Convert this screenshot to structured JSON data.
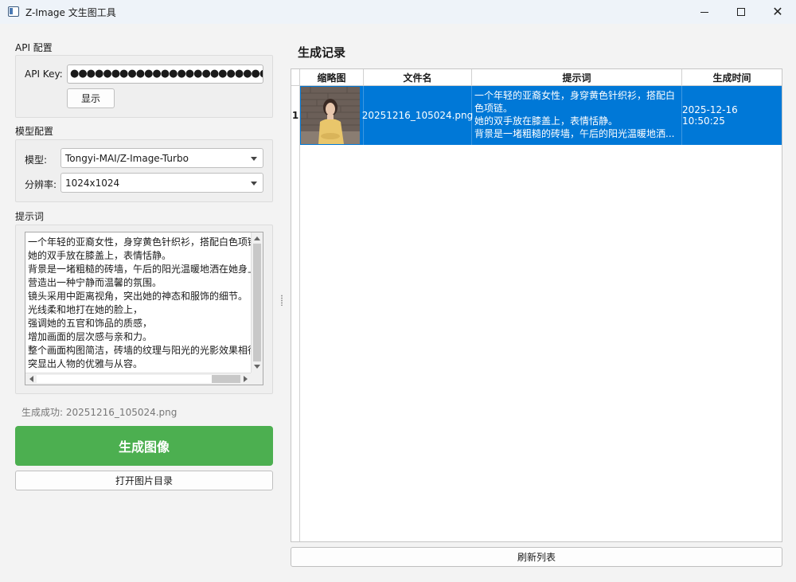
{
  "window": {
    "title": "Z-Image 文生图工具",
    "min_label": "",
    "max_label": "",
    "close_label": "✕"
  },
  "api": {
    "section_label": "API 配置",
    "key_label": "API Key:",
    "key_value": "●●●●●●●●●●●●●●●●●●●●●●●●●●●●●●●",
    "show_button": "显示"
  },
  "model": {
    "section_label": "模型配置",
    "model_label": "模型:",
    "model_value": "Tongyi-MAI/Z-Image-Turbo",
    "resolution_label": "分辨率:",
    "resolution_value": "1024x1024"
  },
  "prompt": {
    "section_label": "提示词",
    "lines": [
      "一个年轻的亚裔女性，身穿黄色针织衫，搭配白色项链。",
      "她的双手放在膝盖上，表情恬静。",
      "背景是一堵粗糙的砖墙，午后的阳光温暖地洒在她身上，",
      "营造出一种宁静而温馨的氛围。",
      "镜头采用中距离视角，突出她的神态和服饰的细节。",
      "光线柔和地打在她的脸上，",
      "强调她的五官和饰品的质感，",
      "增加画面的层次感与亲和力。",
      "整个画面构图简洁，砖墙的纹理与阳光的光影效果相得益彰，",
      "突显出人物的优雅与从容。"
    ]
  },
  "status": "生成成功: 20251216_105024.png",
  "actions": {
    "generate": "生成图像",
    "open_dir": "打开图片目录",
    "refresh": "刷新列表"
  },
  "history": {
    "title": "生成记录",
    "columns": [
      "缩略图",
      "文件名",
      "提示词",
      "生成时间"
    ],
    "rows": [
      {
        "num": "1",
        "file": "20251216_105024.png",
        "prompt_lines": [
          "一个年轻的亚裔女性，身穿黄色针织衫，搭配白",
          "色项链。",
          "她的双手放在膝盖上，表情恬静。",
          "背景是一堵粗糙的砖墙，午后的阳光温暖地洒..."
        ],
        "time": "2025-12-16 10:50:25"
      }
    ]
  },
  "colors": {
    "accent_green": "#4caf50",
    "selection_blue": "#0078d7"
  }
}
